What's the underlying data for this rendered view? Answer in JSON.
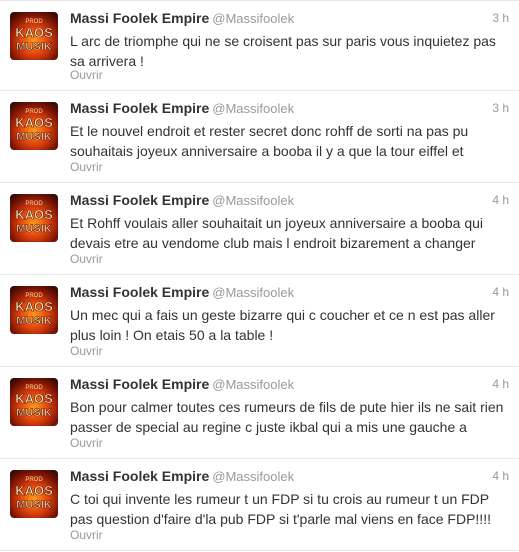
{
  "timeline": {
    "tweets": [
      {
        "name": "Massi Foolek Empire",
        "handle": "@Massifoolek",
        "time": "3 h",
        "text": "L arc de triomphe qui ne se croisent pas sur paris vous inquietez pas sa arrivera !",
        "expand_label": "Ouvrir"
      },
      {
        "name": "Massi Foolek Empire",
        "handle": "@Massifoolek",
        "time": "3 h",
        "text": "Et le nouvel endroit et rester secret donc rohff de sorti na pas pu souhaitais joyeux anniversaire a booba il y a que la tour eiffel et",
        "expand_label": "Ouvrir"
      },
      {
        "name": "Massi Foolek Empire",
        "handle": "@Massifoolek",
        "time": "4 h",
        "text": "Et Rohff voulais aller souhaitait un joyeux anniversaire a booba qui devais etre au vendome club mais l endroit bizarement a changer",
        "expand_label": "Ouvrir"
      },
      {
        "name": "Massi Foolek Empire",
        "handle": "@Massifoolek",
        "time": "4 h",
        "text": "Un mec qui a fais un geste bizarre qui c coucher et ce n est pas aller plus loin ! On etais 50 a la table !",
        "expand_label": "Ouvrir"
      },
      {
        "name": "Massi Foolek Empire",
        "handle": "@Massifoolek",
        "time": "4 h",
        "text": "Bon pour calmer toutes ces rumeurs de fils de pute hier ils ne sait rien passer de special au regine c juste ikbal qui a mis une gauche a",
        "expand_label": "Ouvrir"
      },
      {
        "name": "Massi Foolek Empire",
        "handle": "@Massifoolek",
        "time": "4 h",
        "text": "C toi qui invente les rumeur t un FDP si tu crois au rumeur t un FDP pas question d'faire d'la pub FDP si t'parle mal viens en face FDP!!!!",
        "expand_label": "Ouvrir"
      }
    ],
    "avatar": {
      "logo_top": "KAOS",
      "logo_bottom": "MUSIK",
      "logo_small": "PROD"
    }
  },
  "colors": {
    "name": "#333333",
    "secondary": "#999999",
    "divider": "#e8e8e8",
    "avatar_fire": "#e0420c"
  },
  "icons": {
    "avatar": "kaos-musik-fire-logo"
  }
}
